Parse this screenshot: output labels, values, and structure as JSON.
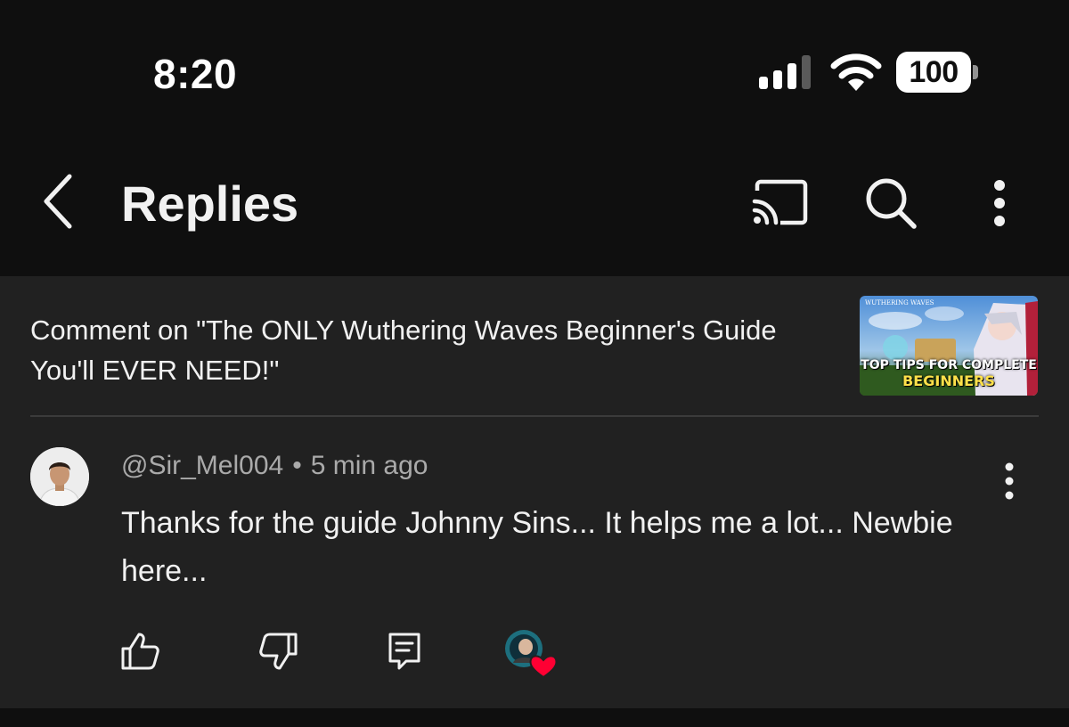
{
  "status_bar": {
    "time": "8:20",
    "battery": "100",
    "icons": [
      "signal-icon",
      "wifi-icon",
      "battery-icon"
    ]
  },
  "header": {
    "title": "Replies",
    "icons": [
      "back-arrow-icon",
      "cast-icon",
      "search-icon",
      "more-vertical-icon"
    ]
  },
  "context": {
    "text": "Comment on \"The ONLY Wuthering Waves Beginner's Guide You'll EVER NEED!\"",
    "thumbnail": {
      "logo": "WUTHERING WAVES",
      "line1": "TOP TIPS FOR COMPLETE",
      "line2": "BEGINNERS"
    }
  },
  "comment": {
    "author": "@Sir_Mel004",
    "separator": "•",
    "time": "5 min ago",
    "text": "Thanks for the guide Johnny Sins... It helps me a lot... Newbie here...",
    "actions": [
      "thumbs-up-icon",
      "thumbs-down-icon",
      "reply-icon",
      "creator-heart-icon"
    ]
  },
  "colors": {
    "background": "#0f0f0f",
    "panel": "#212121",
    "text_primary": "#f1f1f1",
    "text_secondary": "#aaaaaa",
    "heart": "#ff0033"
  }
}
